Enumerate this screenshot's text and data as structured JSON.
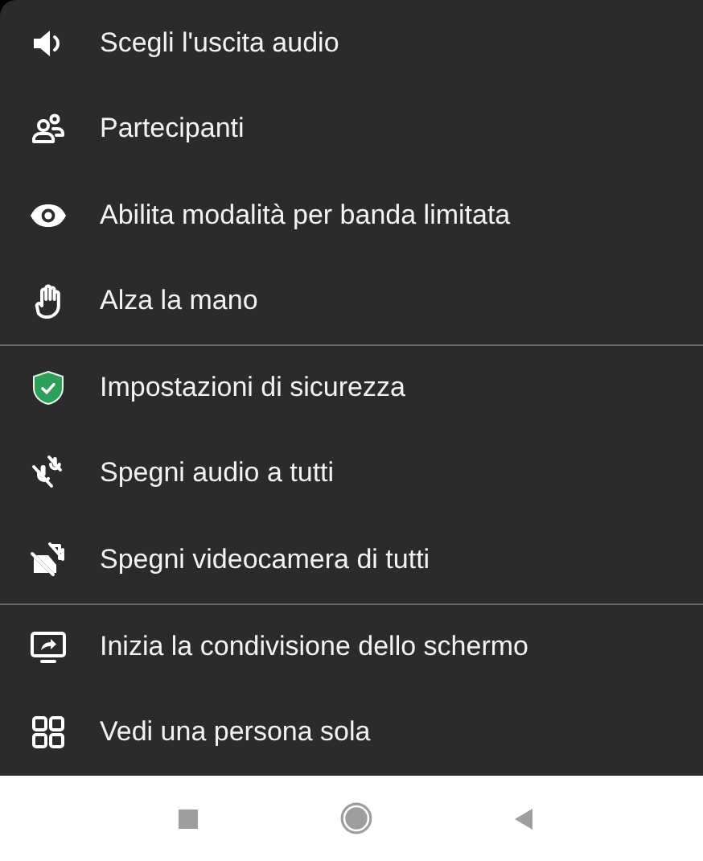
{
  "menu": {
    "sections": [
      {
        "items": [
          {
            "label": "Scegli l'uscita audio"
          },
          {
            "label": "Partecipanti"
          },
          {
            "label": "Abilita modalità per banda limitata"
          },
          {
            "label": "Alza la mano"
          }
        ]
      },
      {
        "items": [
          {
            "label": "Impostazioni di sicurezza"
          },
          {
            "label": "Spegni audio a tutti"
          },
          {
            "label": "Spegni videocamera di tutti"
          }
        ]
      },
      {
        "items": [
          {
            "label": "Inizia la condivisione dello schermo"
          },
          {
            "label": "Vedi una persona sola"
          }
        ]
      }
    ]
  }
}
